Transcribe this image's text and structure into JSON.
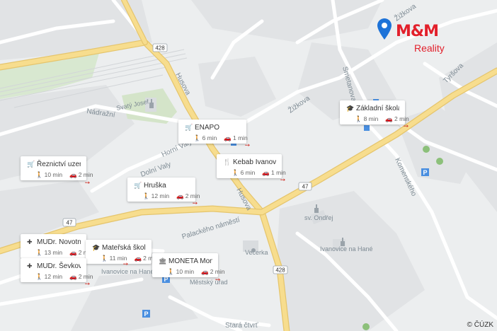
{
  "map": {
    "streets": [
      "Husova",
      "Žižkova",
      "Nádražní",
      "Horní Valy",
      "Dolní Valy",
      "Smetanova",
      "Tyršova",
      "Komenského",
      "Palackého náměstí",
      "Stará čtvrť"
    ],
    "places": [
      "Svatý Josef",
      "sv. Ondřej",
      "Večerka",
      "Ivanovice na Hané",
      "Ivanovice na Hané",
      "Městský úřad"
    ],
    "road_numbers": [
      "428",
      "428",
      "47",
      "47"
    ]
  },
  "pois": [
    {
      "name": "ENAPO",
      "icon": "cart-icon",
      "walk": "6 min",
      "drive": "1 min"
    },
    {
      "name": "Kebab Ivanovice",
      "icon": "fork-knife-icon",
      "walk": "6 min",
      "drive": "1 min"
    },
    {
      "name": "Základní škola Iv...",
      "icon": "school-icon",
      "walk": "8 min",
      "drive": "2 min"
    },
    {
      "name": "Řeznictví uzenářs...",
      "icon": "cart-icon",
      "walk": "10 min",
      "drive": "2 min"
    },
    {
      "name": "Hruška",
      "icon": "cart-icon",
      "walk": "12 min",
      "drive": "2 min"
    },
    {
      "name": "MUDr. Novotná ...",
      "icon": "medical-cross-icon",
      "walk": "13 min",
      "drive": "2 min"
    },
    {
      "name": "Mateřská škola Iv...",
      "icon": "school-icon",
      "walk": "11 min",
      "drive": "2 min"
    },
    {
      "name": "MUDr. Ševková H...",
      "icon": "medical-cross-icon",
      "walk": "12 min",
      "drive": "2 min"
    },
    {
      "name": "MONETA Money ...",
      "icon": "bank-icon",
      "walk": "10 min",
      "drive": "2 min"
    }
  ],
  "logo": {
    "brand": "M&M",
    "sub": "Reality"
  },
  "copyright": "© ČÚZK",
  "colors": {
    "brand": "#e2202b",
    "pin": "#1e73d8",
    "road_major": "#f5d98a"
  }
}
